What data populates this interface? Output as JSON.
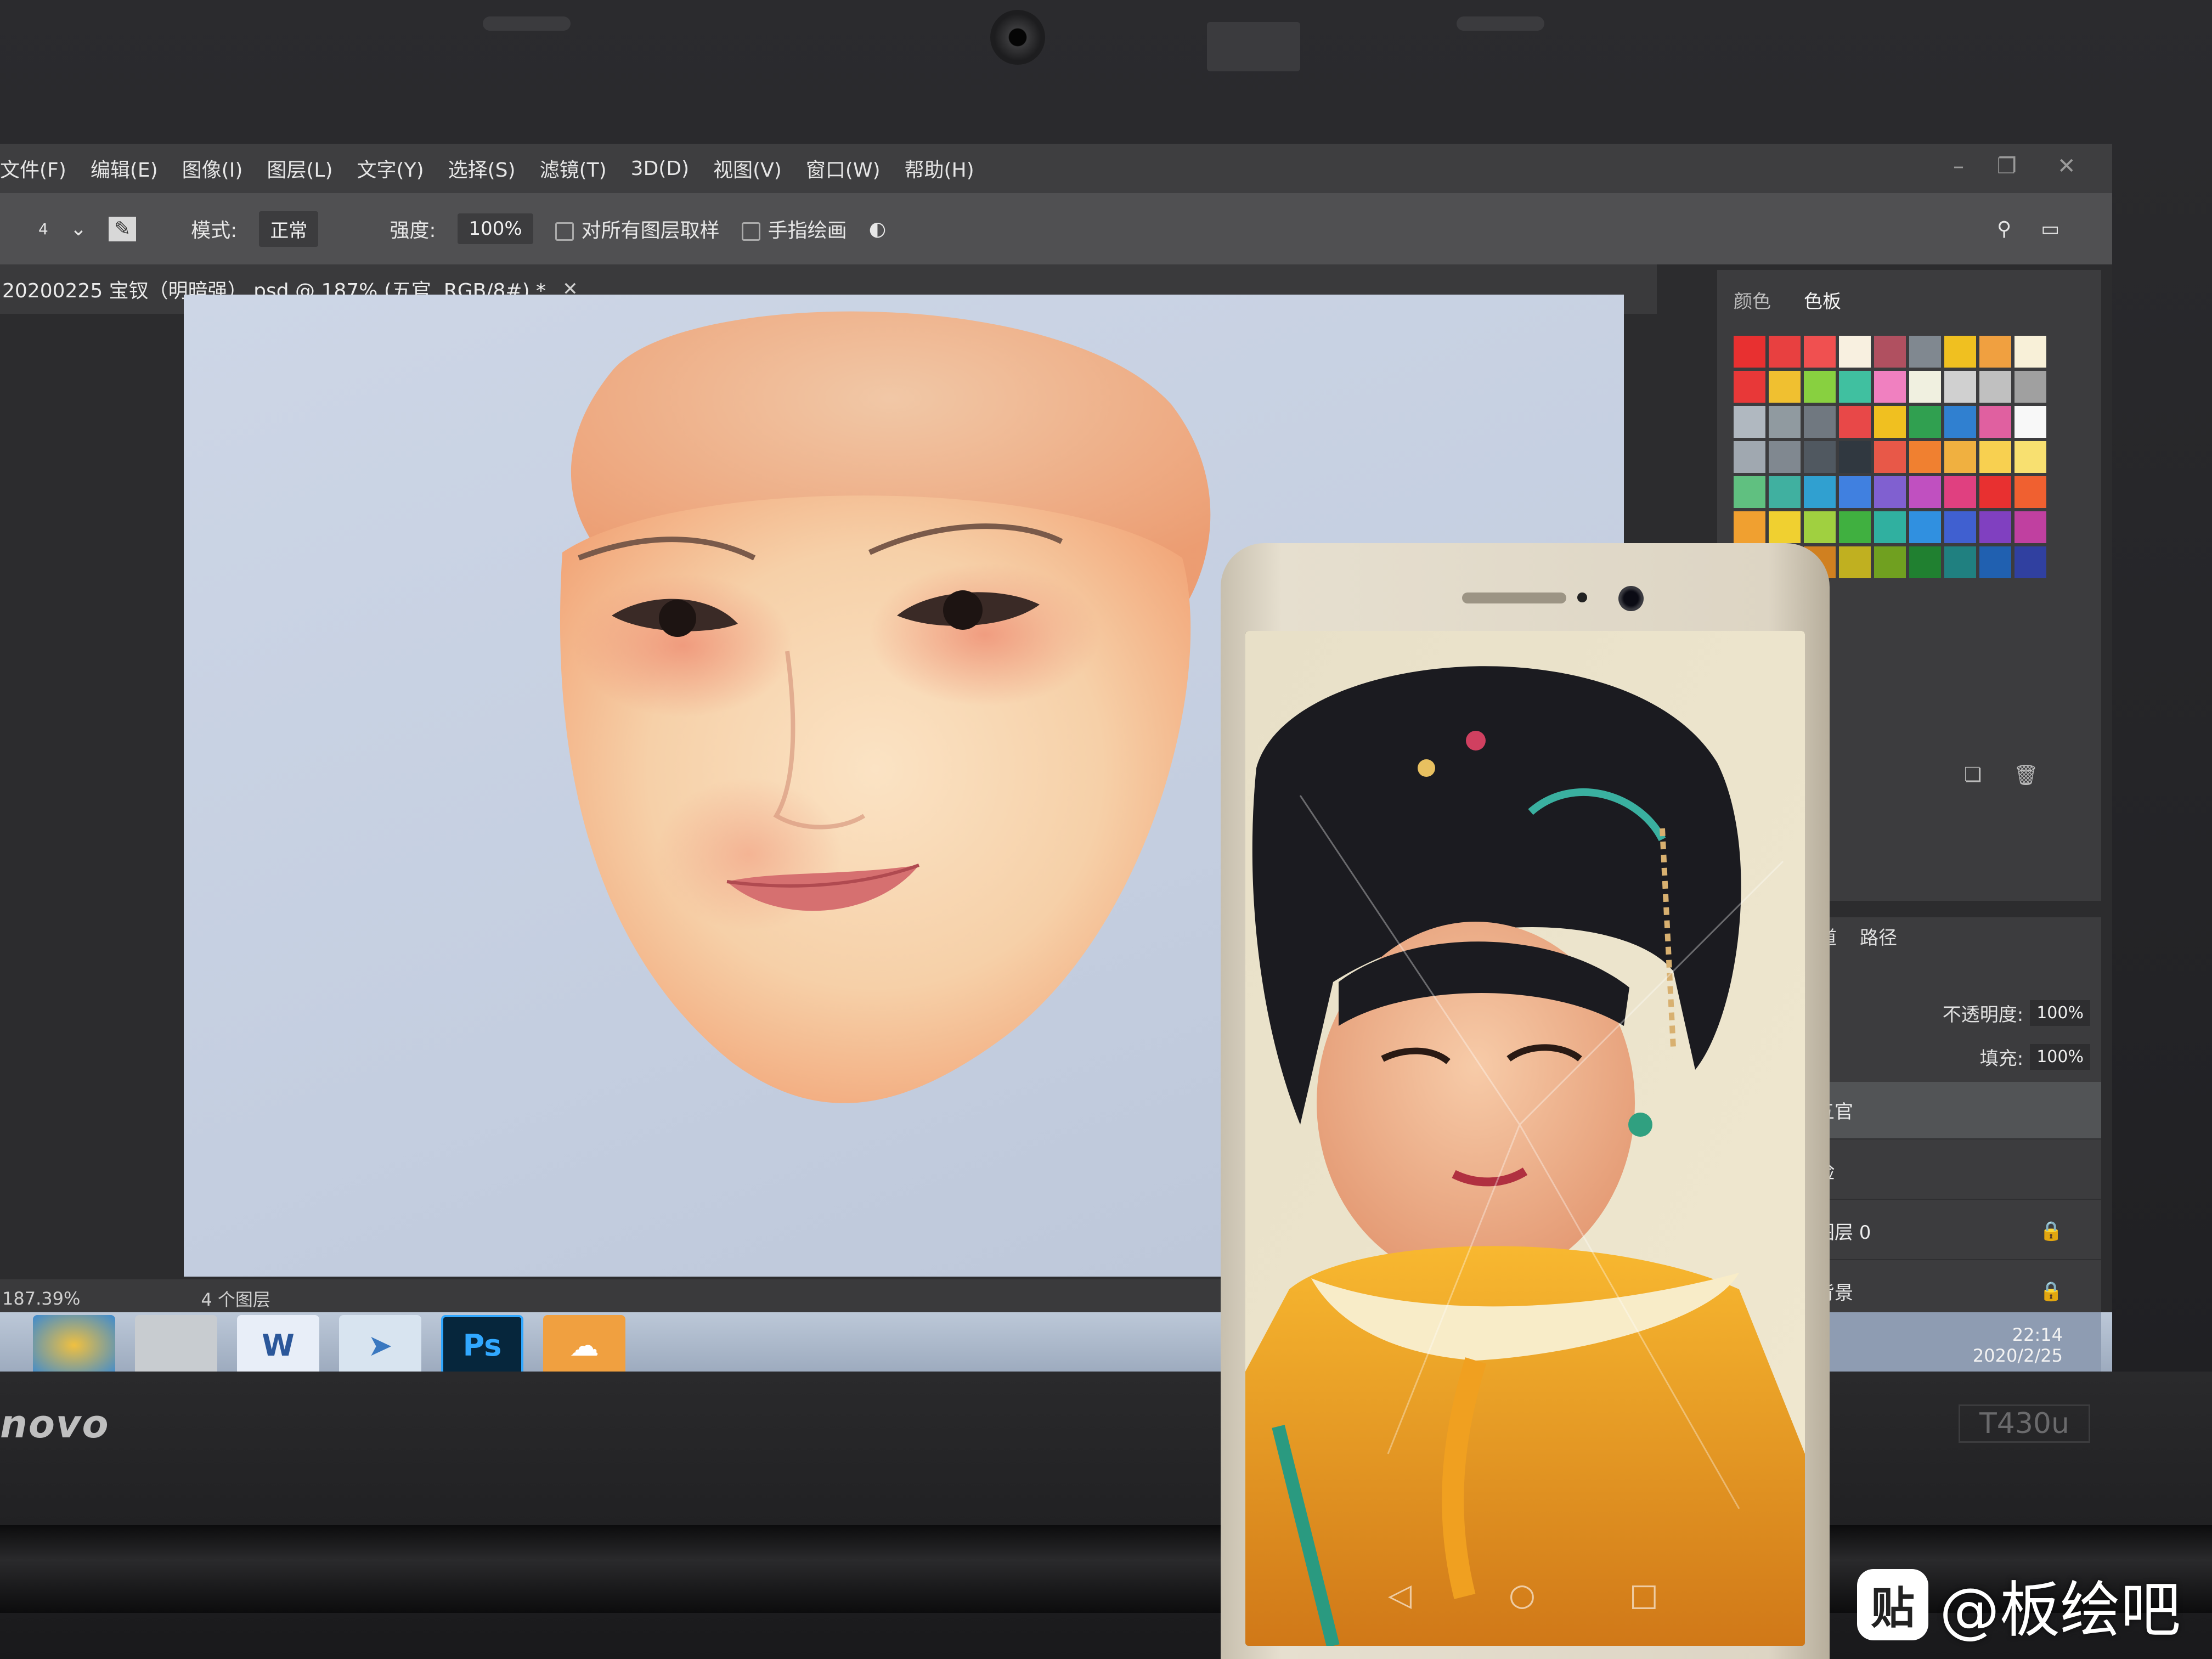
{
  "photoshop": {
    "menu": [
      "文件(F)",
      "编辑(E)",
      "图像(I)",
      "图层(L)",
      "文字(Y)",
      "选择(S)",
      "滤镜(T)",
      "3D(D)",
      "视图(V)",
      "窗口(W)",
      "帮助(H)"
    ],
    "options": {
      "brush_size": "4",
      "mode_label": "模式:",
      "mode_value": "正常",
      "strength_label": "强度:",
      "strength_value": "100%",
      "sample_all_layers": "对所有图层取样",
      "finger_painting": "手指绘画"
    },
    "document_tab": "20200225 宝钗（明暗强）.psd @ 187% (五官, RGB/8#) *",
    "status": {
      "zoom": "187.39%",
      "layers_count": "4 个图层"
    },
    "color_panel_tabs": [
      "颜色",
      "色板"
    ],
    "swatch_colors": [
      "#e83030",
      "#e84040",
      "#f05050",
      "#f8f0e0",
      "#b05060",
      "#808890",
      "#f0c020",
      "#f0a040",
      "#f8f0d8",
      "#e83838",
      "#f0c030",
      "#88d040",
      "#40c0a0",
      "#f080c0",
      "#f0f0e0",
      "#d0d0d0",
      "#c0c0c0",
      "#a0a0a0",
      "#b0b8c0",
      "#909aa0",
      "#707880",
      "#e84848",
      "#f0c020",
      "#30a050",
      "#3080d0",
      "#e060a0",
      "#f8f8f8",
      "#a0a8b0",
      "#808890",
      "#505860",
      "#303840",
      "#e85848",
      "#f08030",
      "#f0b040",
      "#f8d050",
      "#f8e070",
      "#60c080",
      "#40b0a0",
      "#30a0d0",
      "#4080e0",
      "#8060d0",
      "#c050c0",
      "#e04080",
      "#e83030",
      "#f06030",
      "#f0a030",
      "#f0d030",
      "#a0d040",
      "#40b040",
      "#30b0a0",
      "#3090e0",
      "#4060d0",
      "#8040c0",
      "#c040a0",
      "#c82020",
      "#d05020",
      "#d08020",
      "#c0b020",
      "#70a020",
      "#208030",
      "#208080",
      "#2060b0",
      "#3040a0"
    ],
    "layer_panel": {
      "tabs": [
        "通道",
        "路径"
      ],
      "opacity_label": "不透明度:",
      "opacity_value": "100%",
      "fill_label": "填充:",
      "fill_value": "100%",
      "layers": [
        "五官",
        "脸",
        "图层 0",
        "背景"
      ]
    },
    "taskbar": {
      "photoshop_icon": "Ps",
      "word_icon": "W",
      "time": "22:14",
      "date": "2020/2/25"
    }
  },
  "laptop": {
    "brand": "novo",
    "model": "T430u"
  },
  "watermark": {
    "logo": "贴",
    "text": "@板绘吧"
  },
  "colors": {
    "canvas_bg": "#c8d1e2",
    "ps_dark": "#3c3c3e",
    "phone_body": "#ddd5c4"
  }
}
